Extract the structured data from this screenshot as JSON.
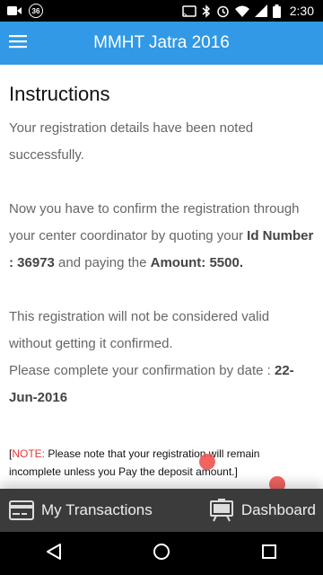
{
  "status_bar": {
    "time": "2:30",
    "notification_badge": "36",
    "icons": [
      "video-camera-icon",
      "circle-badge-icon",
      "cast-icon",
      "bluetooth-icon",
      "alarm-icon",
      "wifi-icon",
      "signal-icon",
      "battery-icon"
    ]
  },
  "app_bar": {
    "title": "MMHT Jatra 2016",
    "color": "#3199e5",
    "menu_icon": "hamburger-menu-icon"
  },
  "instructions": {
    "title": "Instructions",
    "para1": "Your registration details have been noted successfully.",
    "para2_part1": "Now you have to confirm the registration through your center coordinator by quoting your ",
    "id_label": "Id Number : 36973",
    "para2_part2": " and paying the ",
    "amount_label": "Amount: 5500.",
    "para3": "This registration will not be considered valid without getting it confirmed.",
    "para4_part1": "Please complete your confirmation by date : ",
    "confirm_date": "22-Jun-2016",
    "note_open": "[",
    "note_label": "NOTE:",
    "note_text": " Please note that your registration will remain incomplete unless you Pay the deposit amount.]"
  },
  "bottom_bar": {
    "transactions_label": "My Transactions",
    "dashboard_label": "Dashboard",
    "transactions_icon": "credit-card-icon",
    "dashboard_icon": "display-board-icon"
  },
  "nav_bar": {
    "icons": [
      "back-triangle-icon",
      "home-circle-icon",
      "recents-square-icon"
    ]
  },
  "colors": {
    "accent": "#3199e5",
    "note_red": "#e53935",
    "bottom_bar": "#3b3b3b"
  }
}
